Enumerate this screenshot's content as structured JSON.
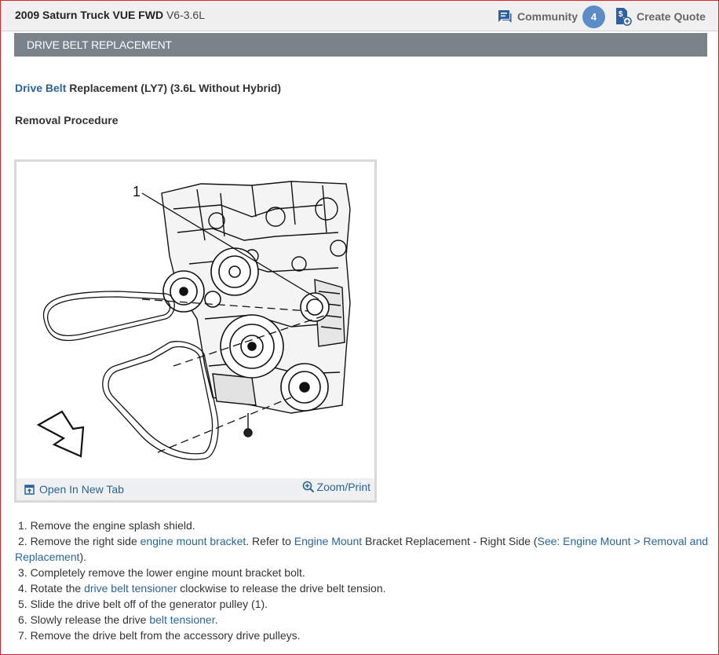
{
  "header": {
    "vehicle_name": "2009 Saturn Truck VUE FWD",
    "engine": "V6-3.6L",
    "community_label": "Community",
    "community_count": "4",
    "create_quote_label": "Create Quote",
    "accent_color": "#5b8cc5"
  },
  "section": {
    "title": "DRIVE BELT REPLACEMENT"
  },
  "article": {
    "subtitle_link": "Drive Belt",
    "subtitle_rest": " Replacement (LY7) (3.6L Without Hybrid)",
    "procedure_heading": "Removal Procedure"
  },
  "figure": {
    "callout": "1",
    "open_tab_label": "Open In New Tab",
    "zoom_label": "Zoom/Print"
  },
  "steps": {
    "s1": "1. Remove the engine splash shield.",
    "s2_a": "2. Remove the right side ",
    "s2_link1": "engine mount bracket",
    "s2_b": ". Refer to ",
    "s2_link2": "Engine Mount",
    "s2_c": " Bracket Replacement - Right Side (",
    "s2_link3": "See: Engine Mount > Removal and Replacement",
    "s2_d": ").",
    "s3": "3. Completely remove the lower engine mount bracket bolt.",
    "s4_a": "4. Rotate the ",
    "s4_link": "drive belt tensioner",
    "s4_b": " clockwise to release the drive belt tension.",
    "s5": "5. Slide the drive belt off of the generator pulley (1).",
    "s6_a": "6. Slowly release the drive ",
    "s6_link": "belt tensioner",
    "s6_b": ".",
    "s7": "7. Remove the drive belt from the accessory drive pulleys."
  }
}
